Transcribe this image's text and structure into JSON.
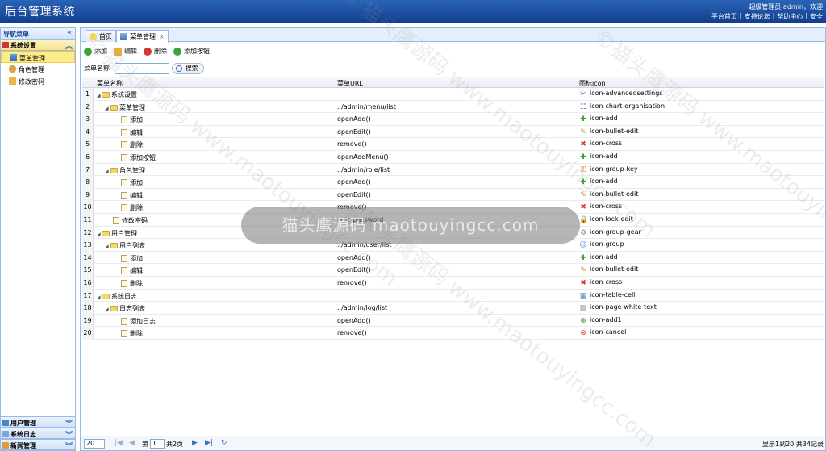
{
  "header": {
    "title": "后台管理系统",
    "welcome": "超级管理员:admin，欢迎",
    "links": [
      "平台首页",
      "支持论坛",
      "帮助中心",
      "安全"
    ]
  },
  "sidebar": {
    "title": "导航菜单",
    "collapse": "«",
    "group_active": "系统设置",
    "items": [
      "菜单管理",
      "角色管理",
      "修改密码"
    ],
    "bottom_groups": [
      "用户管理",
      "系统日志",
      "新闻管理"
    ]
  },
  "tabs": [
    {
      "label": "首页",
      "icon": "lightbulb-icon"
    },
    {
      "label": "菜单管理",
      "icon": "org-chart-icon",
      "close": "×"
    }
  ],
  "toolbar": {
    "add": "添加",
    "edit": "编辑",
    "delete": "删除",
    "add_button": "添加按钮"
  },
  "search": {
    "label": "菜单名称:",
    "value": "",
    "button": "搜索"
  },
  "grid": {
    "columns": [
      "菜单名称",
      "菜单URL",
      "图标icon"
    ],
    "rows": [
      {
        "n": "1",
        "name": "系统设置",
        "url": "",
        "icon": "icon-advancedsettings",
        "level": 0,
        "type": "folder"
      },
      {
        "n": "2",
        "name": "菜单管理",
        "url": "../admin/menu/list",
        "icon": "icon-chart-organisation",
        "level": 1,
        "type": "folder"
      },
      {
        "n": "3",
        "name": "添加",
        "url": "openAdd()",
        "icon": "icon-add",
        "level": 2,
        "type": "file"
      },
      {
        "n": "4",
        "name": "编辑",
        "url": "openEdit()",
        "icon": "icon-bullet-edit",
        "level": 2,
        "type": "file"
      },
      {
        "n": "5",
        "name": "删除",
        "url": "remove()",
        "icon": "icon-cross",
        "level": 2,
        "type": "file"
      },
      {
        "n": "6",
        "name": "添加按钮",
        "url": "openAddMenu()",
        "icon": "icon-add",
        "level": 2,
        "type": "file"
      },
      {
        "n": "7",
        "name": "角色管理",
        "url": "../admin/role/list",
        "icon": "icon-group-key",
        "level": 1,
        "type": "folder"
      },
      {
        "n": "8",
        "name": "添加",
        "url": "openAdd()",
        "icon": "icon-add",
        "level": 2,
        "type": "file"
      },
      {
        "n": "9",
        "name": "编辑",
        "url": "openEdit()",
        "icon": "icon-bullet-edit",
        "level": 2,
        "type": "file"
      },
      {
        "n": "10",
        "name": "删除",
        "url": "remove()",
        "icon": "icon-cross",
        "level": 2,
        "type": "file"
      },
      {
        "n": "11",
        "name": "修改密码",
        "url": "edit_password",
        "icon": "icon-lock-edit",
        "level": 1,
        "type": "file"
      },
      {
        "n": "12",
        "name": "用户管理",
        "url": "",
        "icon": "icon-group-gear",
        "level": 0,
        "type": "folder"
      },
      {
        "n": "13",
        "name": "用户列表",
        "url": "../admin/user/list",
        "icon": "icon-group",
        "level": 1,
        "type": "folder"
      },
      {
        "n": "14",
        "name": "添加",
        "url": "openAdd()",
        "icon": "icon-add",
        "level": 2,
        "type": "file"
      },
      {
        "n": "15",
        "name": "编辑",
        "url": "openEdit()",
        "icon": "icon-bullet-edit",
        "level": 2,
        "type": "file"
      },
      {
        "n": "16",
        "name": "删除",
        "url": "remove()",
        "icon": "icon-cross",
        "level": 2,
        "type": "file"
      },
      {
        "n": "17",
        "name": "系统日志",
        "url": "",
        "icon": "icon-table-cell",
        "level": 0,
        "type": "folder"
      },
      {
        "n": "18",
        "name": "日志列表",
        "url": "../admin/log/list",
        "icon": "icon-page-white-text",
        "level": 1,
        "type": "folder"
      },
      {
        "n": "19",
        "name": "添加日志",
        "url": "openAdd()",
        "icon": "icon-add1",
        "level": 2,
        "type": "file"
      },
      {
        "n": "20",
        "name": "删除",
        "url": "remove()",
        "icon": "icon-cancel",
        "level": 2,
        "type": "file"
      }
    ]
  },
  "pager": {
    "page_size": "20",
    "page_label": "第",
    "page": "1",
    "total_pages": "共2页",
    "info": "显示1到20,共34记录"
  },
  "overlay": "猫头鹰源码 maotouyingcc.com",
  "watermark": "©猫头鹰源码 www.maotouyingcc.com",
  "colors": {
    "header": "#1c4fa0",
    "border": "#99bbe8",
    "active": "#fbec88"
  }
}
